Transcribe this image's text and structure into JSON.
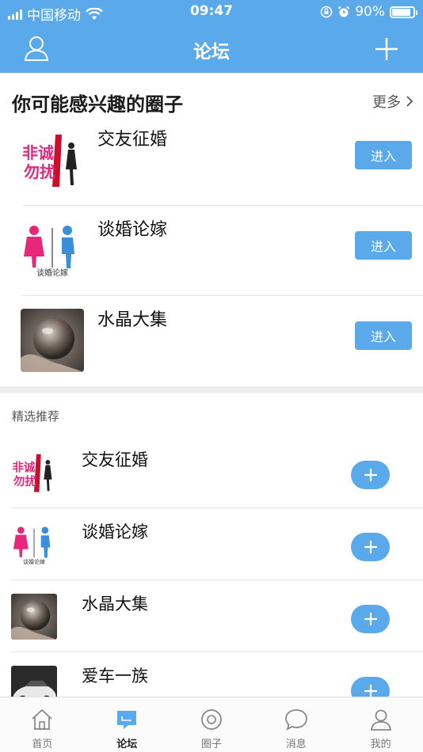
{
  "status_bar": {
    "carrier": "中国移动",
    "time": "09:47",
    "battery": "90%",
    "battery_level": 0.9,
    "icons": [
      "signal-icon",
      "wifi-icon",
      "rotation-lock-icon",
      "alarm-icon",
      "battery-icon"
    ]
  },
  "nav": {
    "title": "论坛",
    "left_icon": "user-icon",
    "right_icon": "plus-icon"
  },
  "interest_section": {
    "title": "你可能感兴趣的圈子",
    "more_label": "更多",
    "items": [
      {
        "name": "交友征婚",
        "button": "进入",
        "thumb": "dating-logo"
      },
      {
        "name": "谈婚论嫁",
        "button": "进入",
        "thumb": "marriage-logo",
        "thumb_caption": "谈婚论嫁"
      },
      {
        "name": "水晶大集",
        "button": "进入",
        "thumb": "crystal-ball-photo"
      }
    ]
  },
  "featured_section": {
    "title": "精选推荐",
    "items": [
      {
        "name": "交友征婚",
        "thumb": "dating-logo"
      },
      {
        "name": "谈婚论嫁",
        "thumb": "marriage-logo",
        "thumb_caption": "谈婚论嫁"
      },
      {
        "name": "水晶大集",
        "thumb": "crystal-ball-photo"
      },
      {
        "name": "爱车一族",
        "thumb": "car-photo"
      }
    ]
  },
  "tab_bar": {
    "items": [
      {
        "label": "首页",
        "icon": "home-icon"
      },
      {
        "label": "论坛",
        "icon": "forum-icon",
        "active": true
      },
      {
        "label": "圈子",
        "icon": "circle-icon"
      },
      {
        "label": "消息",
        "icon": "message-icon"
      },
      {
        "label": "我的",
        "icon": "profile-icon"
      }
    ]
  },
  "colors": {
    "accent": "#5aa9ea",
    "divider": "#e6e6e6",
    "band": "#eeeeee"
  }
}
